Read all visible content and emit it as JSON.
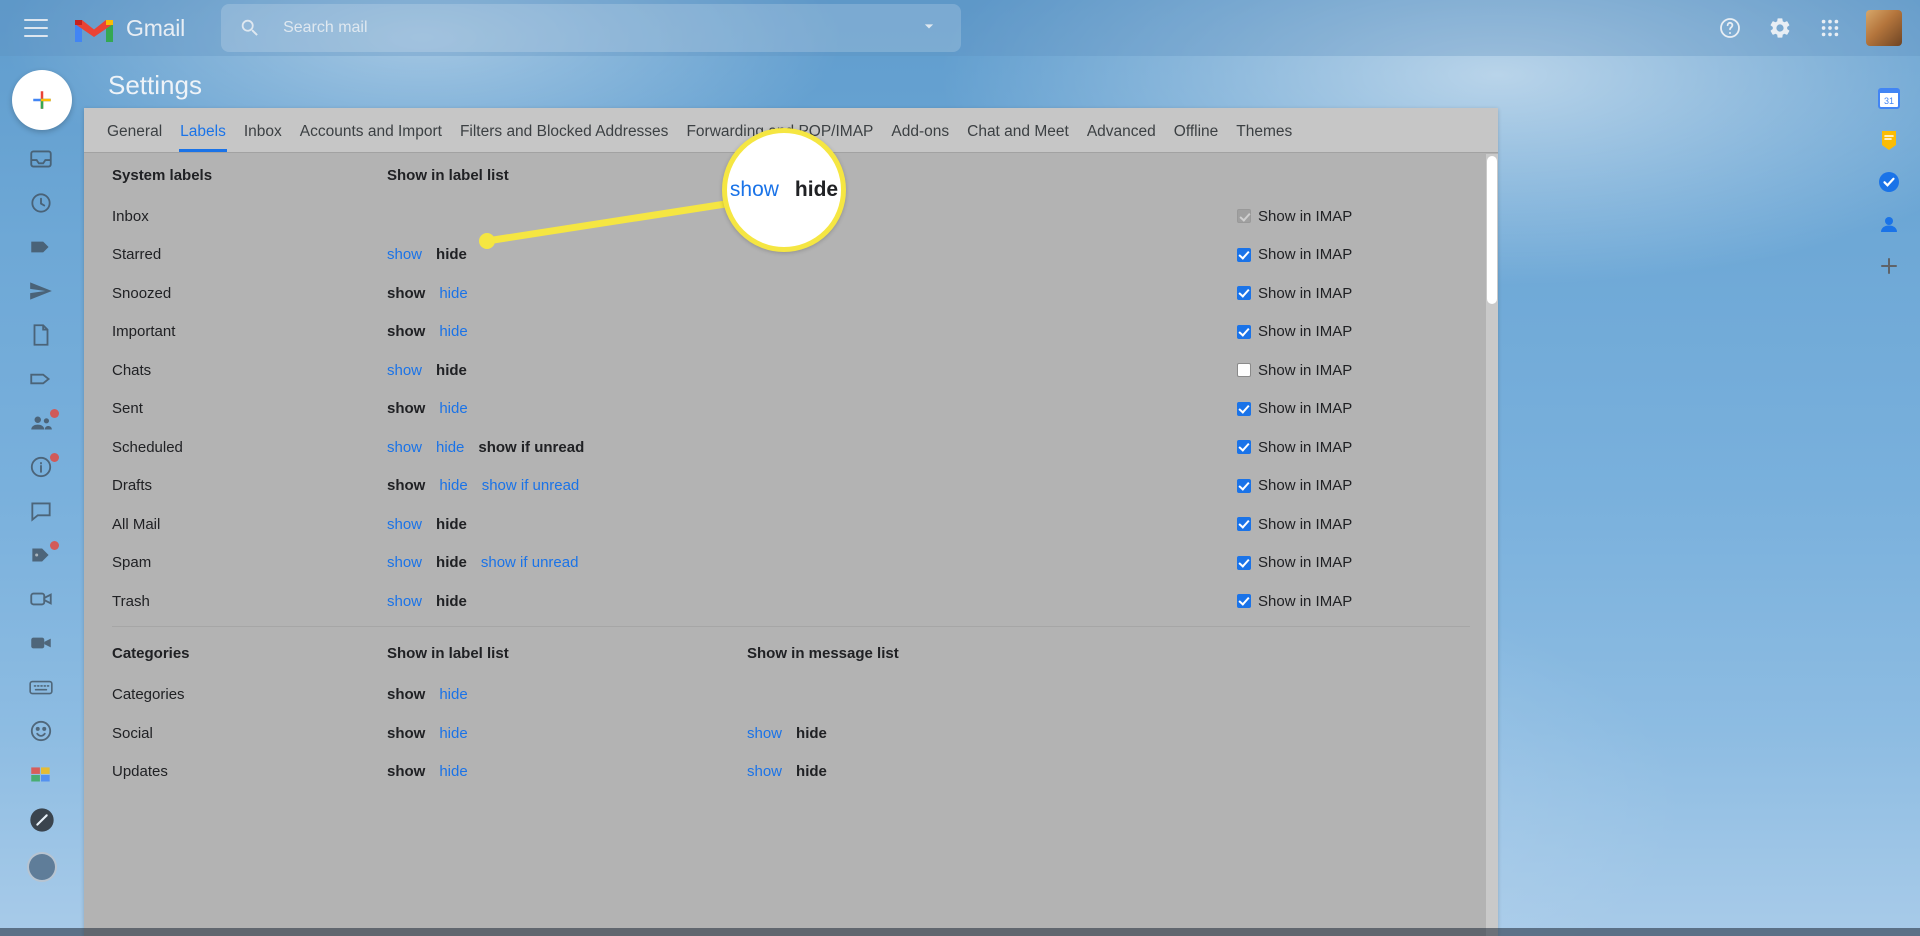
{
  "topbar": {
    "menu_icon": "hamburger-menu-icon",
    "brand": "Gmail",
    "search_placeholder": "Search mail",
    "search_value": "",
    "search_icon": "search-icon",
    "filter_icon": "search-options-chevron-icon",
    "help_icon": "help-icon",
    "settings_icon": "gear-icon",
    "apps_icon": "google-apps-grid-icon",
    "avatar": "account-avatar"
  },
  "page": {
    "title": "Settings"
  },
  "tabs": [
    {
      "label": "General",
      "active": false
    },
    {
      "label": "Labels",
      "active": true
    },
    {
      "label": "Inbox",
      "active": false
    },
    {
      "label": "Accounts and Import",
      "active": false
    },
    {
      "label": "Filters and Blocked Addresses",
      "active": false
    },
    {
      "label": "Forwarding and POP/IMAP",
      "active": false
    },
    {
      "label": "Add-ons",
      "active": false
    },
    {
      "label": "Chat and Meet",
      "active": false
    },
    {
      "label": "Advanced",
      "active": false
    },
    {
      "label": "Offline",
      "active": false
    },
    {
      "label": "Themes",
      "active": false
    }
  ],
  "sections": [
    {
      "id": "system-labels",
      "title": "System labels",
      "col_label_list": "Show in label list",
      "col_message_list": "",
      "imap_label": "Show in IMAP",
      "rows": [
        {
          "label": "Inbox",
          "label_list": [],
          "message_list": [],
          "imap": "disabled"
        },
        {
          "label": "Starred",
          "label_list": [
            {
              "text": "show",
              "state": "link"
            },
            {
              "text": "hide",
              "state": "active"
            }
          ],
          "message_list": [],
          "imap": "checked"
        },
        {
          "label": "Snoozed",
          "label_list": [
            {
              "text": "show",
              "state": "active"
            },
            {
              "text": "hide",
              "state": "link"
            }
          ],
          "message_list": [],
          "imap": "checked"
        },
        {
          "label": "Important",
          "label_list": [
            {
              "text": "show",
              "state": "active"
            },
            {
              "text": "hide",
              "state": "link"
            }
          ],
          "message_list": [],
          "imap": "checked"
        },
        {
          "label": "Chats",
          "label_list": [
            {
              "text": "show",
              "state": "link"
            },
            {
              "text": "hide",
              "state": "active"
            }
          ],
          "message_list": [],
          "imap": "unchecked"
        },
        {
          "label": "Sent",
          "label_list": [
            {
              "text": "show",
              "state": "active"
            },
            {
              "text": "hide",
              "state": "link"
            }
          ],
          "message_list": [],
          "imap": "checked"
        },
        {
          "label": "Scheduled",
          "label_list": [
            {
              "text": "show",
              "state": "link"
            },
            {
              "text": "hide",
              "state": "link"
            },
            {
              "text": "show if unread",
              "state": "active"
            }
          ],
          "message_list": [],
          "imap": "checked"
        },
        {
          "label": "Drafts",
          "label_list": [
            {
              "text": "show",
              "state": "active"
            },
            {
              "text": "hide",
              "state": "link"
            },
            {
              "text": "show if unread",
              "state": "link"
            }
          ],
          "message_list": [],
          "imap": "checked"
        },
        {
          "label": "All Mail",
          "label_list": [
            {
              "text": "show",
              "state": "link"
            },
            {
              "text": "hide",
              "state": "active"
            }
          ],
          "message_list": [],
          "imap": "checked"
        },
        {
          "label": "Spam",
          "label_list": [
            {
              "text": "show",
              "state": "link"
            },
            {
              "text": "hide",
              "state": "active"
            },
            {
              "text": "show if unread",
              "state": "link"
            }
          ],
          "message_list": [],
          "imap": "checked"
        },
        {
          "label": "Trash",
          "label_list": [
            {
              "text": "show",
              "state": "link"
            },
            {
              "text": "hide",
              "state": "active"
            }
          ],
          "message_list": [],
          "imap": "checked"
        }
      ]
    },
    {
      "id": "categories",
      "title": "Categories",
      "col_label_list": "Show in label list",
      "col_message_list": "Show in message list",
      "imap_label": "",
      "rows": [
        {
          "label": "Categories",
          "label_list": [
            {
              "text": "show",
              "state": "active"
            },
            {
              "text": "hide",
              "state": "link"
            }
          ],
          "message_list": [],
          "imap": "none"
        },
        {
          "label": "Social",
          "label_list": [
            {
              "text": "show",
              "state": "active"
            },
            {
              "text": "hide",
              "state": "link"
            }
          ],
          "message_list": [
            {
              "text": "show",
              "state": "link"
            },
            {
              "text": "hide",
              "state": "active"
            }
          ],
          "imap": "none"
        },
        {
          "label": "Updates",
          "label_list": [
            {
              "text": "show",
              "state": "active"
            },
            {
              "text": "hide",
              "state": "link"
            }
          ],
          "message_list": [
            {
              "text": "show",
              "state": "link"
            },
            {
              "text": "hide",
              "state": "active"
            }
          ],
          "imap": "none"
        }
      ]
    }
  ],
  "callout": {
    "options": [
      {
        "text": "show",
        "state": "link"
      },
      {
        "text": "hide",
        "state": "active"
      }
    ],
    "highlight_color": "#f5e642"
  },
  "left_rail": {
    "compose_label": "compose-plus-icon",
    "items": [
      {
        "icon": "inbox-icon",
        "badge": false
      },
      {
        "icon": "clock-snoozed-icon",
        "badge": false
      },
      {
        "icon": "label-tag-icon",
        "badge": false
      },
      {
        "icon": "send-icon",
        "badge": false
      },
      {
        "icon": "drafts-file-icon",
        "badge": false
      },
      {
        "icon": "tag-outline-icon",
        "badge": false
      },
      {
        "icon": "people-chat-icon",
        "badge": true
      },
      {
        "icon": "info-circle-icon",
        "badge": true
      },
      {
        "icon": "chat-bubble-icon",
        "badge": false
      },
      {
        "icon": "labels-icon",
        "badge": true
      },
      {
        "icon": "video-outline-icon",
        "badge": false
      },
      {
        "icon": "video-camera-icon",
        "badge": false
      },
      {
        "icon": "keyboard-icon",
        "badge": false
      },
      {
        "icon": "face-smile-icon",
        "badge": false
      },
      {
        "icon": "palette-icon",
        "badge": false
      },
      {
        "icon": "dark-circle-icon",
        "badge": false
      }
    ]
  },
  "right_panel": {
    "items": [
      {
        "icon": "google-calendar-icon",
        "color": "#4285f4"
      },
      {
        "icon": "google-keep-icon",
        "color": "#fbbc04"
      },
      {
        "icon": "google-tasks-icon",
        "color": "#1a73e8"
      },
      {
        "icon": "google-contacts-icon",
        "color": "#1a73e8"
      },
      {
        "icon": "add-addon-plus-icon",
        "color": "#5f6368"
      }
    ]
  },
  "scrollbar": {
    "name": "settings-vertical-scrollbar"
  }
}
